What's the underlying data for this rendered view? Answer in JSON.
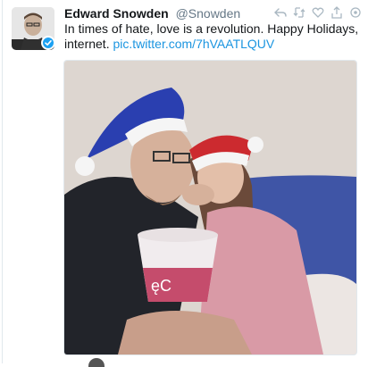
{
  "tweet": {
    "name": "Edward Snowden",
    "handle": "@Snowden",
    "text": "In times of hate, love is a revolution. Happy Holidays, internet.",
    "link": "pic.twitter.com/7hVAATLQUV"
  },
  "icons": {
    "actions": [
      "reply-icon",
      "retweet-icon",
      "like-icon",
      "share-icon",
      "more-icon"
    ],
    "verified": "verified-badge-icon"
  },
  "colors": {
    "link": "#1b95e0",
    "verified": "#1da1f2",
    "handle": "#657786"
  }
}
